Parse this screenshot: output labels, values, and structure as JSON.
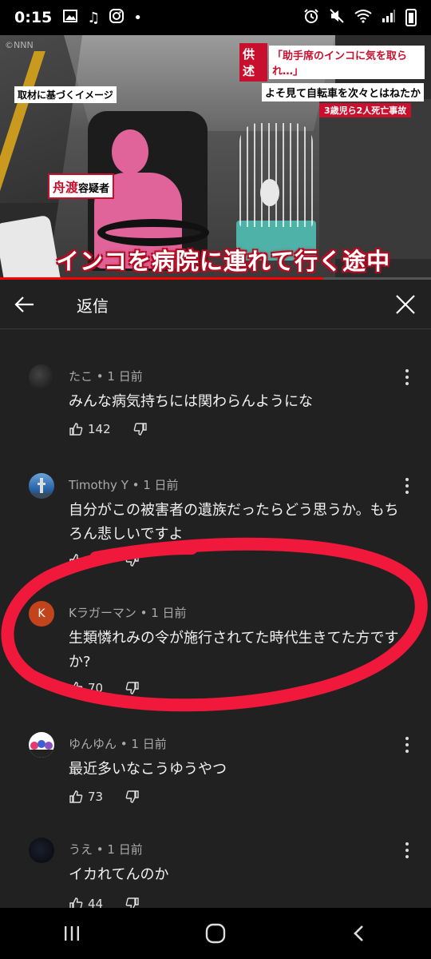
{
  "status_bar": {
    "time": "0:15",
    "left_icons": [
      "gallery-icon",
      "music-icon",
      "instagram-icon",
      "dot-icon"
    ],
    "right_icons": [
      "alarm-icon",
      "mute-icon",
      "wifi-icon",
      "signal-icon",
      "battery-icon"
    ]
  },
  "video": {
    "watermark": "©NNN",
    "image_note": "取材に基づくイメージ",
    "name_tag_name": "舟渡",
    "name_tag_role": "容疑者",
    "headline_tag": "供述",
    "headline_line1": "「助手席のインコに気を取られ…」",
    "headline_line2": "よそ見て自転車を次々とはねたか",
    "headline_line3": "3歳児ら2人死亡事故",
    "caption": "インコを病院に連れて行く途中",
    "progress_fraction": 0.75
  },
  "panel": {
    "title": "返信"
  },
  "comments": [
    {
      "author": "たこ",
      "time": "1 日前",
      "text": "みんな病気持ちには関わらんようにな",
      "likes": "142",
      "avatar": "dark-photo"
    },
    {
      "author": "Timothy Y",
      "time": "1 日前",
      "text": "自分がこの被害者の遺族だったらどう思うか。もちろん悲しいですよ",
      "likes": "38",
      "avatar": "tower-photo"
    },
    {
      "author": "Kラガーマン",
      "time": "1 日前",
      "text": "生類憐れみの令が施行されてた時代生きてた方ですか?",
      "likes": "70",
      "avatar": "letter",
      "avatar_letter": "K",
      "avatar_color": "#c1441d"
    },
    {
      "author": "ゆんゆん",
      "time": "1 日前",
      "text": "最近多いなこうゆうやつ",
      "likes": "73",
      "avatar": "group-photo"
    },
    {
      "author": "うえ",
      "time": "1 日前",
      "text": "イカれてんのか",
      "likes": "44",
      "avatar": "dark-photo"
    }
  ],
  "colors": {
    "panel_bg": "#212121",
    "accent_red": "#ff0000",
    "annotation_red": "#f0193c"
  },
  "navbar": {
    "buttons": [
      "recent-apps-icon",
      "home-icon",
      "back-icon"
    ]
  }
}
